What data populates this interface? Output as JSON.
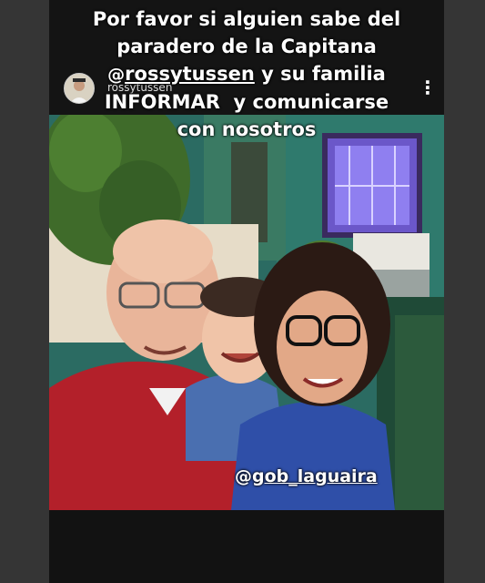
{
  "story": {
    "username": "rossytussen",
    "more_icon": "more-vertical-icon",
    "caption": {
      "line1": "Por favor si alguien sabe del",
      "line2": "paradero de la Capitana",
      "mention_symbol": "@",
      "mention": "rossytussen",
      "line3_rest": " y su familia",
      "line4": "INFORMAR  y comunicarse",
      "line5": "con nosotros"
    },
    "tag": {
      "symbol": "@",
      "handle": "gob_laguaira"
    }
  }
}
